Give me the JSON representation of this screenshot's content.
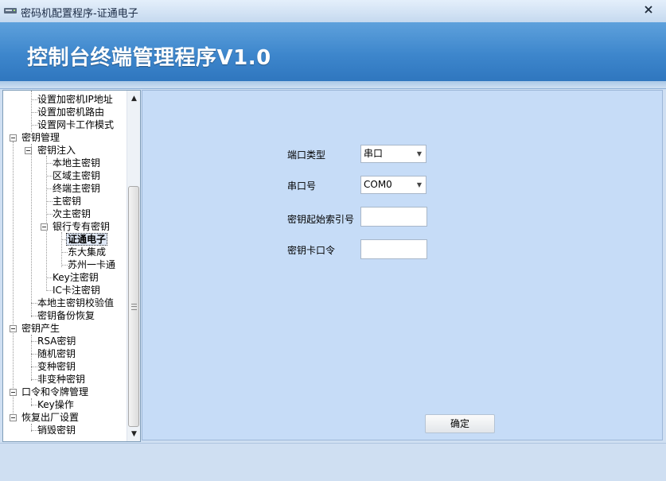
{
  "window": {
    "title": "密码机配置程序-证通电子",
    "close_glyph": "✕"
  },
  "banner": {
    "title": "控制台终端管理程序V1.0"
  },
  "tree": {
    "items": [
      {
        "label": "设置加密机IP地址"
      },
      {
        "label": "设置加密机路由"
      },
      {
        "label": "设置网卡工作模式"
      },
      {
        "label": "密钥管理"
      },
      {
        "label": "密钥注入"
      },
      {
        "label": "本地主密钥"
      },
      {
        "label": "区域主密钥"
      },
      {
        "label": "终端主密钥"
      },
      {
        "label": "主密钥"
      },
      {
        "label": "次主密钥"
      },
      {
        "label": "银行专有密钥"
      },
      {
        "label": "证通电子",
        "selected": true
      },
      {
        "label": "东大集成"
      },
      {
        "label": "苏州一卡通"
      },
      {
        "label": "Key注密钥"
      },
      {
        "label": "IC卡注密钥"
      },
      {
        "label": "本地主密钥校验值"
      },
      {
        "label": "密钥备份恢复"
      },
      {
        "label": "密钥产生"
      },
      {
        "label": "RSA密钥"
      },
      {
        "label": "随机密钥"
      },
      {
        "label": "变种密钥"
      },
      {
        "label": "非变种密钥"
      },
      {
        "label": "口令和令牌管理"
      },
      {
        "label": "Key操作"
      },
      {
        "label": "恢复出厂设置"
      },
      {
        "label": "销毁密钥"
      }
    ],
    "scroll_up_glyph": "▲",
    "scroll_down_glyph": "▼"
  },
  "form": {
    "port_type_label": "端口类型",
    "port_type_value": "串口",
    "serial_port_label": "串口号",
    "serial_port_value": "COM0",
    "key_start_index_label": "密钥起始索引号",
    "key_start_index_value": "",
    "key_card_password_label": "密钥卡口令",
    "key_card_password_value": "",
    "dropdown_glyph": "▼",
    "ok_label": "确定"
  },
  "colors": {
    "banner": "#3d86cc",
    "content_bg": "#c6dcf7",
    "window_bg": "#cfdff2"
  }
}
